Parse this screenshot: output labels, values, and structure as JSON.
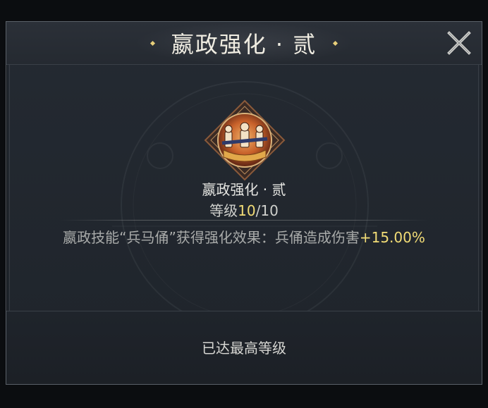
{
  "dialog": {
    "title": "嬴政强化 · 贰",
    "close_icon": "close-x-icon"
  },
  "skill": {
    "icon": "terracotta-warriors-icon",
    "name": "嬴政强化 · 贰",
    "level_label": "等级",
    "level_current": "10",
    "level_max": "/10"
  },
  "description": {
    "text": "嬴政技能“兵马俑”获得强化效果：兵俑造成伤害",
    "value": "+15.00%"
  },
  "footer": {
    "status": "已达最高等级"
  },
  "colors": {
    "accent_gold": "#f2dc76",
    "title_text": "#f0ede2",
    "panel_bg": "#242a32"
  }
}
